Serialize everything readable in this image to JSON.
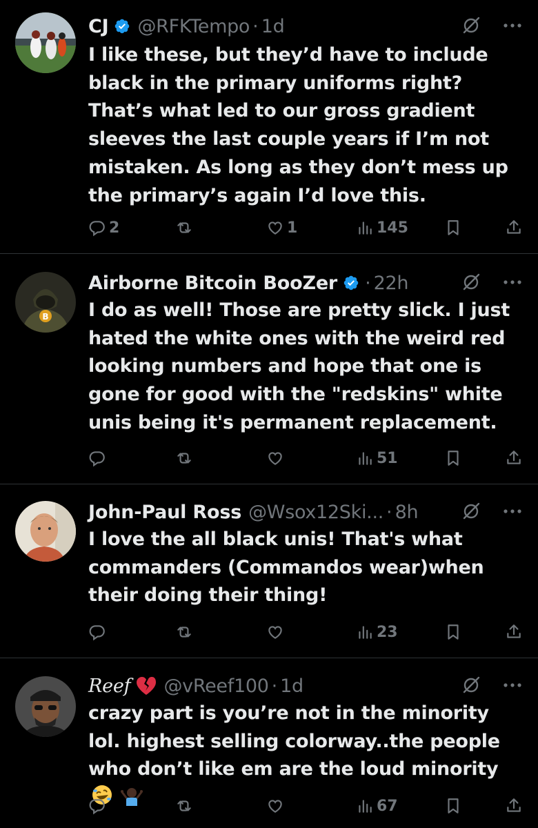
{
  "tweets": [
    {
      "name": "CJ",
      "verified": true,
      "handle": "@RFKTempo",
      "dot": "·",
      "time": "1d",
      "text": "I like these, but they’d have to include black in the primary uniforms right? That’s what led to our gross gradient sleeves the last couple years if I’m not mistaken. As long as they don’t mess up the primary’s again I’d love this.",
      "replies": "2",
      "reposts": "",
      "likes": "1",
      "views": "145"
    },
    {
      "name": "Airborne Bitcoin BooZer",
      "verified": true,
      "handle": "",
      "dot": "·",
      "time": "22h",
      "text": "I do as well! Those are pretty slick. I just hated the white ones with the weird red looking numbers and hope that one is gone for good with the \"redskins\" white unis being it's permanent replacement.",
      "replies": "",
      "reposts": "",
      "likes": "",
      "views": "51"
    },
    {
      "name": "John-Paul Ross",
      "verified": false,
      "handle": "@Wsox12Ski...",
      "dot": "·",
      "time": "8h",
      "text": "I love the all black unis! That's what commanders (Commandos wear)when their doing their thing!",
      "replies": "",
      "reposts": "",
      "likes": "",
      "views": "23"
    },
    {
      "name": "Reef",
      "verified": false,
      "handle": "@vReef100",
      "dot": "·",
      "time": "1d",
      "text": "crazy part is you’re not in the minority lol. highest selling colorway..the people who don’t like em are the loud minority",
      "replies": "",
      "reposts": "",
      "likes": "",
      "views": "67"
    }
  ],
  "icons": {
    "verified": "verified-badge-icon",
    "grok": "grok-icon",
    "more": "more-icon",
    "reply": "reply-icon",
    "repost": "repost-icon",
    "like": "like-icon",
    "views": "views-icon",
    "bookmark": "bookmark-icon",
    "share": "share-icon",
    "broken_heart": "broken-heart-emoji",
    "laughing": "rolling-on-floor-laughing-emoji",
    "shrug": "person-shrugging-emoji"
  },
  "colors": {
    "background": "#000000",
    "text": "#e7e9ea",
    "secondary": "#71767b",
    "divider": "#2f3336",
    "verified": "#1d9bf0"
  }
}
